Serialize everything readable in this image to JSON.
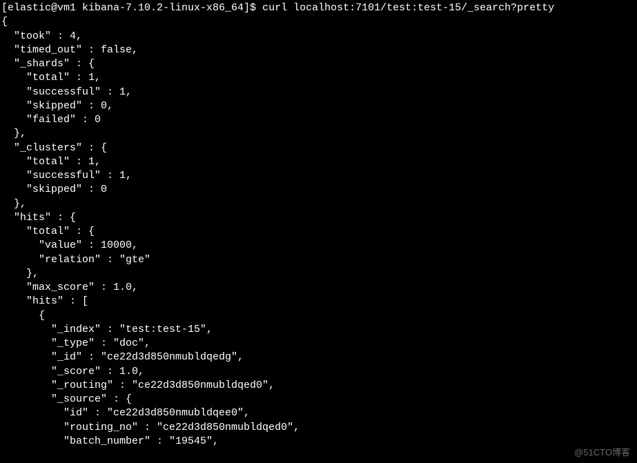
{
  "prompt": {
    "user_host": "[elastic@vm1 kibana-7.10.2-linux-x86_64]$ ",
    "command": "curl localhost:7101/test:test-15/_search?pretty"
  },
  "output": {
    "lines": [
      "{",
      "  \"took\" : 4,",
      "  \"timed_out\" : false,",
      "  \"_shards\" : {",
      "    \"total\" : 1,",
      "    \"successful\" : 1,",
      "    \"skipped\" : 0,",
      "    \"failed\" : 0",
      "  },",
      "  \"_clusters\" : {",
      "    \"total\" : 1,",
      "    \"successful\" : 1,",
      "    \"skipped\" : 0",
      "  },",
      "  \"hits\" : {",
      "    \"total\" : {",
      "      \"value\" : 10000,",
      "      \"relation\" : \"gte\"",
      "    },",
      "    \"max_score\" : 1.0,",
      "    \"hits\" : [",
      "      {",
      "        \"_index\" : \"test:test-15\",",
      "        \"_type\" : \"doc\",",
      "        \"_id\" : \"ce22d3d850nmubldqedg\",",
      "        \"_score\" : 1.0,",
      "        \"_routing\" : \"ce22d3d850nmubldqed0\",",
      "        \"_source\" : {",
      "          \"id\" : \"ce22d3d850nmubldqee0\",",
      "          \"routing_no\" : \"ce22d3d850nmubldqed0\",",
      "          \"batch_number\" : \"19545\","
    ]
  },
  "watermark": "@51CTO博客"
}
